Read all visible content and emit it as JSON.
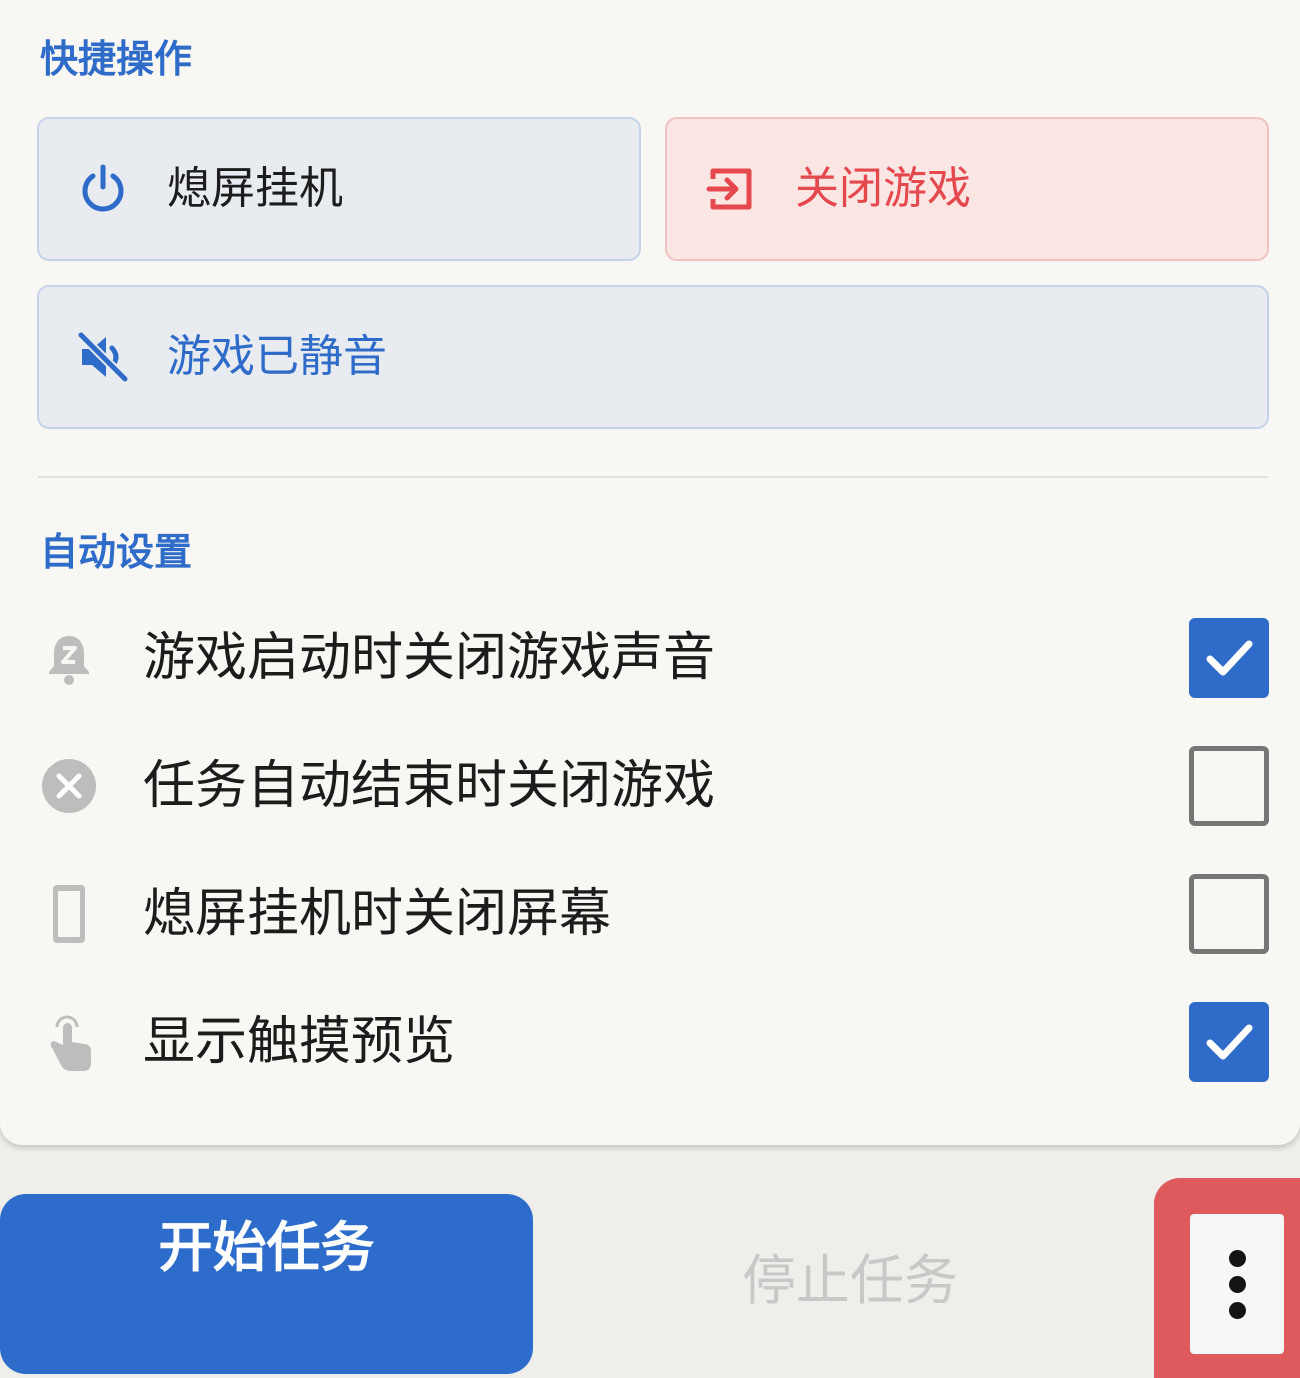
{
  "quick_actions": {
    "title": "快捷操作",
    "screen_off": {
      "label": "熄屏挂机",
      "icon": "power-icon"
    },
    "close_game": {
      "label": "关闭游戏",
      "icon": "exit-icon"
    },
    "mute": {
      "label": "游戏已静音",
      "icon": "volume-off-icon"
    }
  },
  "auto_settings": {
    "title": "自动设置",
    "items": [
      {
        "label": "游戏启动时关闭游戏声音",
        "icon": "bell-sleep-icon",
        "checked": true
      },
      {
        "label": "任务自动结束时关闭游戏",
        "icon": "close-circle-icon",
        "checked": false
      },
      {
        "label": "熄屏挂机时关闭屏幕",
        "icon": "phone-icon",
        "checked": false
      },
      {
        "label": "显示触摸预览",
        "icon": "touch-icon",
        "checked": true
      }
    ]
  },
  "footer": {
    "start_label": "开始任务",
    "stop_label": "停止任务",
    "more_icon": "more-vertical-icon"
  },
  "colors": {
    "accent": "#2f6bc8",
    "danger": "#e5484d",
    "highlight": "#de5a5c"
  }
}
